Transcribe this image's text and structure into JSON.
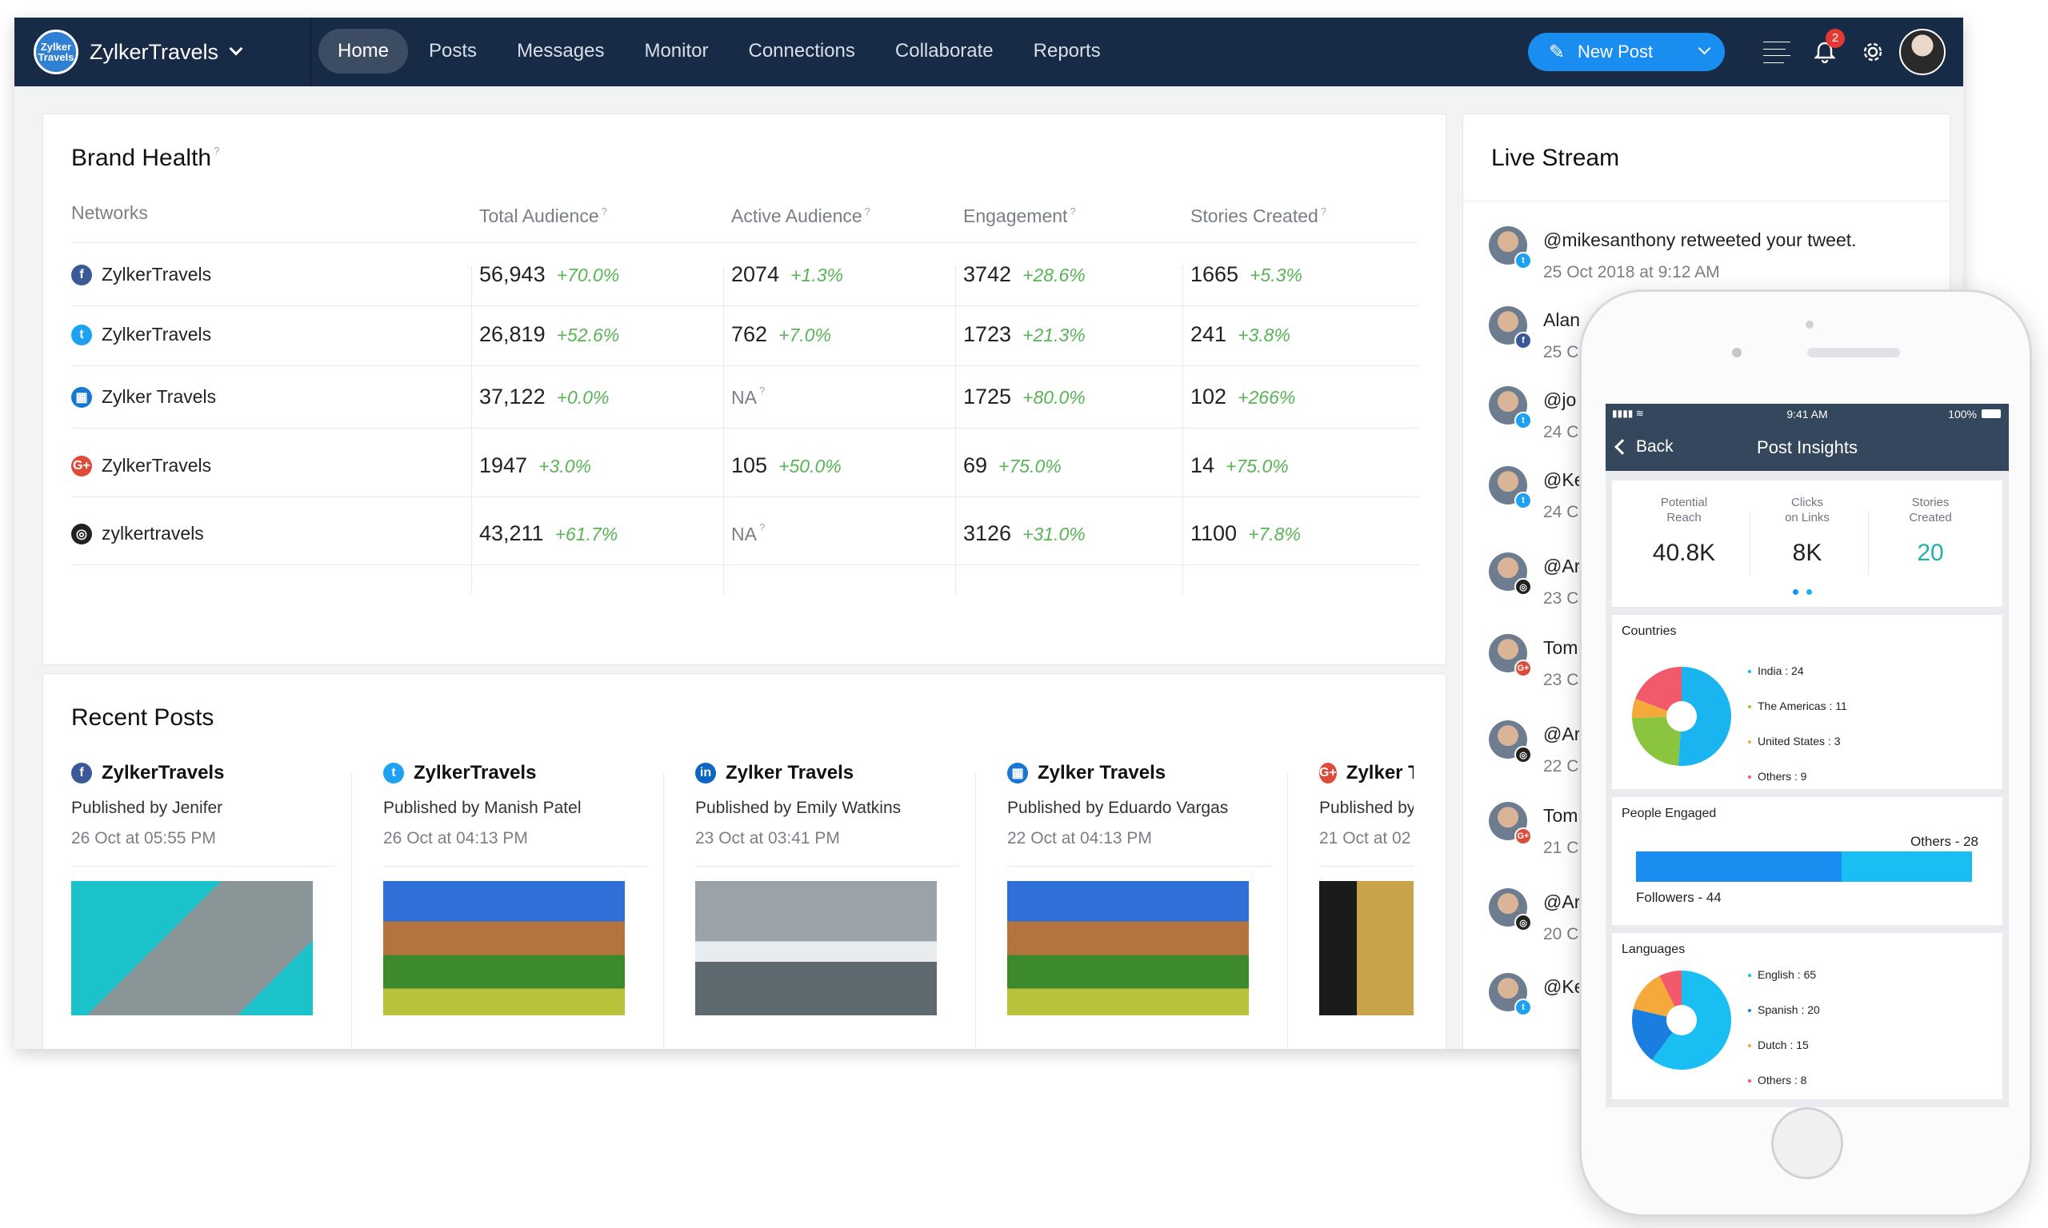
{
  "app": {
    "brand_logo_text": "Zylker Travels",
    "brand_name": "ZylkerTravels",
    "nav": [
      "Home",
      "Posts",
      "Messages",
      "Monitor",
      "Connections",
      "Collaborate",
      "Reports"
    ],
    "active_nav": "Home",
    "new_post_label": "New Post",
    "notification_count": "2"
  },
  "brand_health": {
    "title": "Brand Health",
    "help": "?",
    "columns": [
      "Networks",
      "Total Audience",
      "Active Audience",
      "Engagement",
      "Stories Created"
    ],
    "rows": [
      {
        "network": "facebook",
        "name": "ZylkerTravels",
        "total": "56,943",
        "total_chg": "+70.0%",
        "active": "2074",
        "active_chg": "+1.3%",
        "eng": "3742",
        "eng_chg": "+28.6%",
        "stories": "1665",
        "stories_chg": "+5.3%"
      },
      {
        "network": "twitter",
        "name": "ZylkerTravels",
        "total": "26,819",
        "total_chg": "+52.6%",
        "active": "762",
        "active_chg": "+7.0%",
        "eng": "1723",
        "eng_chg": "+21.3%",
        "stories": "241",
        "stories_chg": "+3.8%"
      },
      {
        "network": "linkedin-page",
        "name": "Zylker Travels",
        "total": "37,122",
        "total_chg": "+0.0%",
        "active": "NA",
        "active_chg": "",
        "eng": "1725",
        "eng_chg": "+80.0%",
        "stories": "102",
        "stories_chg": "+266%"
      },
      {
        "network": "google-plus",
        "name": "ZylkerTravels",
        "total": "1947",
        "total_chg": "+3.0%",
        "active": "105",
        "active_chg": "+50.0%",
        "eng": "69",
        "eng_chg": "+75.0%",
        "stories": "14",
        "stories_chg": "+75.0%"
      },
      {
        "network": "instagram",
        "name": "zylkertravels",
        "total": "43,211",
        "total_chg": "+61.7%",
        "active": "NA",
        "active_chg": "",
        "eng": "3126",
        "eng_chg": "+31.0%",
        "stories": "1100",
        "stories_chg": "+7.8%"
      }
    ]
  },
  "recent_posts": {
    "title": "Recent Posts",
    "posts": [
      {
        "network": "facebook",
        "name": "ZylkerTravels",
        "by": "Published by Jenifer",
        "date": "26 Oct at 05:55 PM"
      },
      {
        "network": "twitter",
        "name": "ZylkerTravels",
        "by": "Published by Manish Patel",
        "date": "26 Oct at 04:13 PM"
      },
      {
        "network": "linkedin",
        "name": "Zylker Travels",
        "by": "Published by Emily Watkins",
        "date": "23 Oct at 03:41 PM"
      },
      {
        "network": "linkedin-page",
        "name": "Zylker Travels",
        "by": "Published by Eduardo Vargas",
        "date": "22 Oct at 04:13 PM"
      },
      {
        "network": "google-plus",
        "name": "Zylker T",
        "by": "Published by",
        "date": "21 Oct at 02"
      }
    ]
  },
  "live_stream": {
    "title": "Live Stream",
    "items": [
      {
        "text": "@mikesanthony retweeted your tweet.",
        "time": "25 Oct 2018 at 9:12 AM",
        "net": "twitter"
      },
      {
        "text": "Alan",
        "time": "25 C",
        "net": "facebook"
      },
      {
        "text": "@jo",
        "time": "24 C",
        "net": "twitter"
      },
      {
        "text": "@Ke",
        "time": "24 C",
        "net": "twitter"
      },
      {
        "text": "@Ar",
        "time": "23 C",
        "net": "instagram"
      },
      {
        "text": "Tom",
        "time": "23 C",
        "net": "google-plus"
      },
      {
        "text": "@Ar",
        "time": "22 C",
        "net": "instagram"
      },
      {
        "text": "Tom",
        "time": "21 C",
        "net": "google-plus"
      },
      {
        "text": "@Ar",
        "time": "20 C",
        "net": "instagram"
      },
      {
        "text": "@Ke",
        "time": "",
        "net": "twitter"
      }
    ]
  },
  "phone": {
    "time": "9:41 AM",
    "battery": "100%",
    "back": "Back",
    "title": "Post Insights",
    "stats": [
      {
        "label1": "Potential",
        "label2": "Reach",
        "value": "40.8K"
      },
      {
        "label1": "Clicks",
        "label2": "on Links",
        "value": "8K"
      },
      {
        "label1": "Stories",
        "label2": "Created",
        "value": "20"
      }
    ],
    "stories_color": "#1fb3a8",
    "countries": {
      "title": "Countries",
      "items": [
        {
          "label": "India : 24",
          "value": 24,
          "color": "#1ab4f0"
        },
        {
          "label": "The Americas : 11",
          "value": 11,
          "color": "#8bc53f"
        },
        {
          "label": "United States : 3",
          "value": 3,
          "color": "#f4a93a"
        },
        {
          "label": "Others : 9",
          "value": 9,
          "color": "#f25a6c"
        }
      ]
    },
    "people": {
      "title": "People Engaged",
      "followers_label": "Followers - 44",
      "followers": 44,
      "others_label": "Others - 28",
      "others": 28
    },
    "languages": {
      "title": "Languages",
      "items": [
        {
          "label": "English : 65",
          "value": 65,
          "color": "#19bff2"
        },
        {
          "label": "Spanish : 20",
          "value": 20,
          "color": "#1a7de0"
        },
        {
          "label": "Dutch : 15",
          "value": 15,
          "color": "#f4a93a"
        },
        {
          "label": "Others : 8",
          "value": 8,
          "color": "#f25a6c"
        }
      ]
    }
  }
}
